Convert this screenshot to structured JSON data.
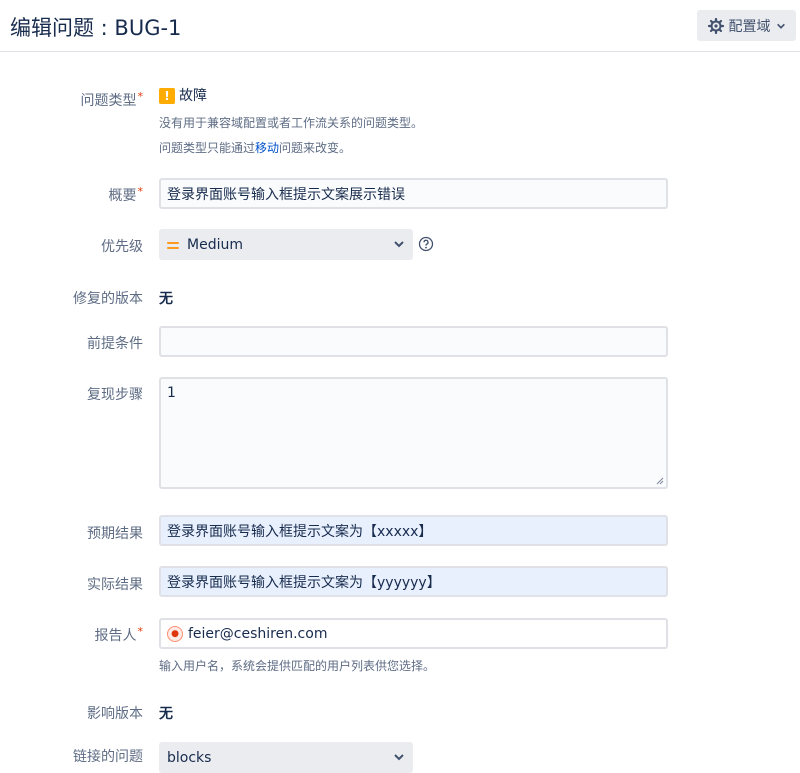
{
  "header": {
    "title": "编辑问题 : BUG-1",
    "config_label": "配置域"
  },
  "fields": {
    "issue_type": {
      "label": "问题类型",
      "value": "故障",
      "hint1": "没有用于兼容域配置或者工作流关系的问题类型。",
      "hint2_pre": "问题类型只能通过",
      "hint2_link": "移动",
      "hint2_post": "问题来改变。"
    },
    "summary": {
      "label": "概要",
      "value": "登录界面账号输入框提示文案展示错误"
    },
    "priority": {
      "label": "优先级",
      "value": "Medium"
    },
    "fix_version": {
      "label": "修复的版本",
      "value": "无"
    },
    "precondition": {
      "label": "前提条件",
      "value": ""
    },
    "steps": {
      "label": "复现步骤",
      "value": "1"
    },
    "expected": {
      "label": "预期结果",
      "value": "登录界面账号输入框提示文案为【xxxxx】"
    },
    "actual": {
      "label": "实际结果",
      "value": "登录界面账号输入框提示文案为【yyyyyy】"
    },
    "reporter": {
      "label": "报告人",
      "value": "feier@ceshiren.com",
      "hint": "输入用户名，系统会提供匹配的用户列表供您选择。"
    },
    "affects_version": {
      "label": "影响版本",
      "value": "无"
    },
    "linked_issues": {
      "label": "链接的问题",
      "value": "blocks"
    }
  },
  "colors": {
    "accent": "#0052cc",
    "required": "#de350b",
    "warning": "#ffab00",
    "priority_medium": "#ff991f"
  },
  "icons": [
    "gear-icon",
    "warning-icon",
    "priority-medium-icon",
    "chevron-down-icon",
    "help-icon",
    "avatar-icon"
  ]
}
